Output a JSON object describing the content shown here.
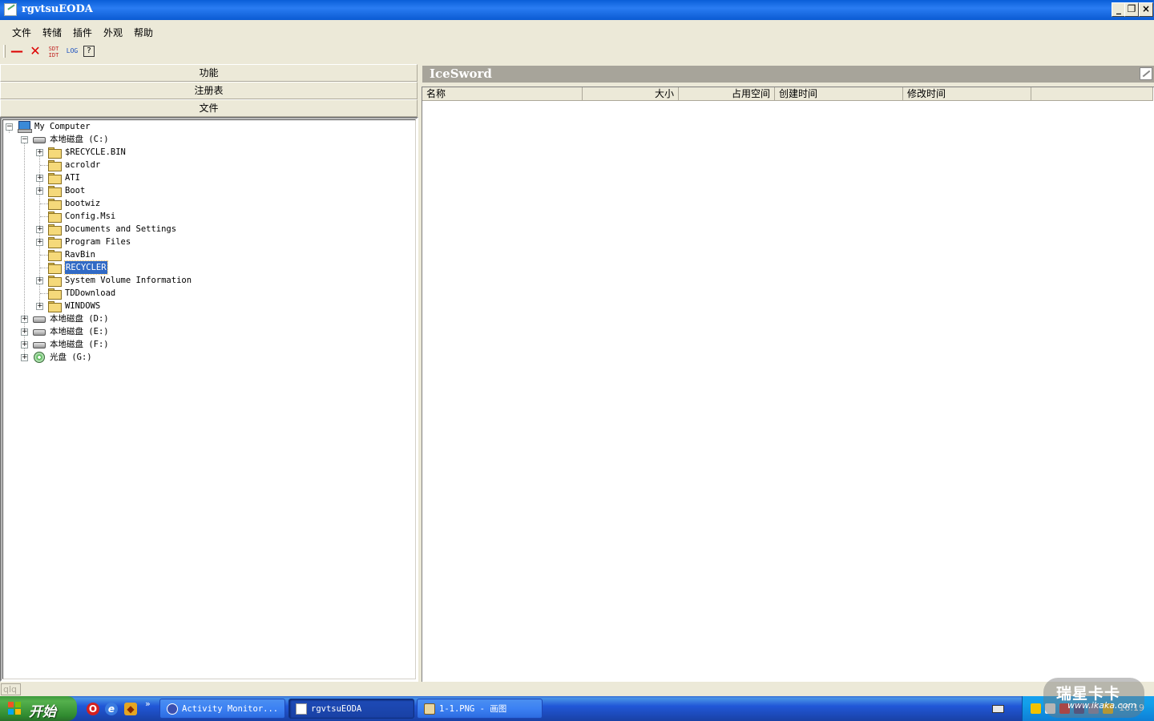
{
  "window": {
    "title": "rgvtsuEODA",
    "minimize": "_",
    "maximize": "❐",
    "close": "×"
  },
  "menu": [
    "文件",
    "转储",
    "插件",
    "外观",
    "帮助"
  ],
  "toolbar": {
    "sdt_label": "SDT\nIDT",
    "log_label": "LOG",
    "help_label": "?"
  },
  "sections": {
    "functions": "功能",
    "registry": "注册表",
    "files": "文件"
  },
  "tree": {
    "root": "My Computer",
    "drive_c": "本地磁盘 (C:)",
    "c_folders": [
      {
        "name": "$RECYCLE.BIN",
        "expandable": true
      },
      {
        "name": "acroldr",
        "expandable": false
      },
      {
        "name": "ATI",
        "expandable": true
      },
      {
        "name": "Boot",
        "expandable": true
      },
      {
        "name": "bootwiz",
        "expandable": false
      },
      {
        "name": "Config.Msi",
        "expandable": false
      },
      {
        "name": "Documents and Settings",
        "expandable": true
      },
      {
        "name": "Program Files",
        "expandable": true
      },
      {
        "name": "RavBin",
        "expandable": false
      },
      {
        "name": "RECYCLER",
        "expandable": false,
        "selected": true
      },
      {
        "name": "System Volume Information",
        "expandable": true
      },
      {
        "name": "TDDownload",
        "expandable": false
      },
      {
        "name": "WINDOWS",
        "expandable": true
      }
    ],
    "other_drives": [
      {
        "name": "本地磁盘 (D:)",
        "type": "disk"
      },
      {
        "name": "本地磁盘 (E:)",
        "type": "disk"
      },
      {
        "name": "本地磁盘 (F:)",
        "type": "disk"
      },
      {
        "name": "光盘 (G:)",
        "type": "cdrom"
      }
    ]
  },
  "right_panel": {
    "title": "IceSword",
    "columns": [
      "名称",
      "大小",
      "占用空间",
      "创建时间",
      "修改时间"
    ]
  },
  "status": {
    "cell": "qlq"
  },
  "taskbar": {
    "start": "开始",
    "more": "»",
    "tasks": [
      {
        "label": "Activity Monitor...",
        "active": false
      },
      {
        "label": "rgvtsuEODA",
        "active": true
      },
      {
        "label": "1-1.PNG - 画图",
        "active": false
      }
    ],
    "clock": "16:19"
  },
  "watermark": {
    "main": "瑞星卡卡",
    "sub": "www.ikaka.com"
  },
  "colors": {
    "titlebar": "#0a5fd8",
    "selection": "#316ac5",
    "panel_header": "#a7a49a",
    "taskbar": "#2157d7",
    "start": "#3c9a3c"
  }
}
